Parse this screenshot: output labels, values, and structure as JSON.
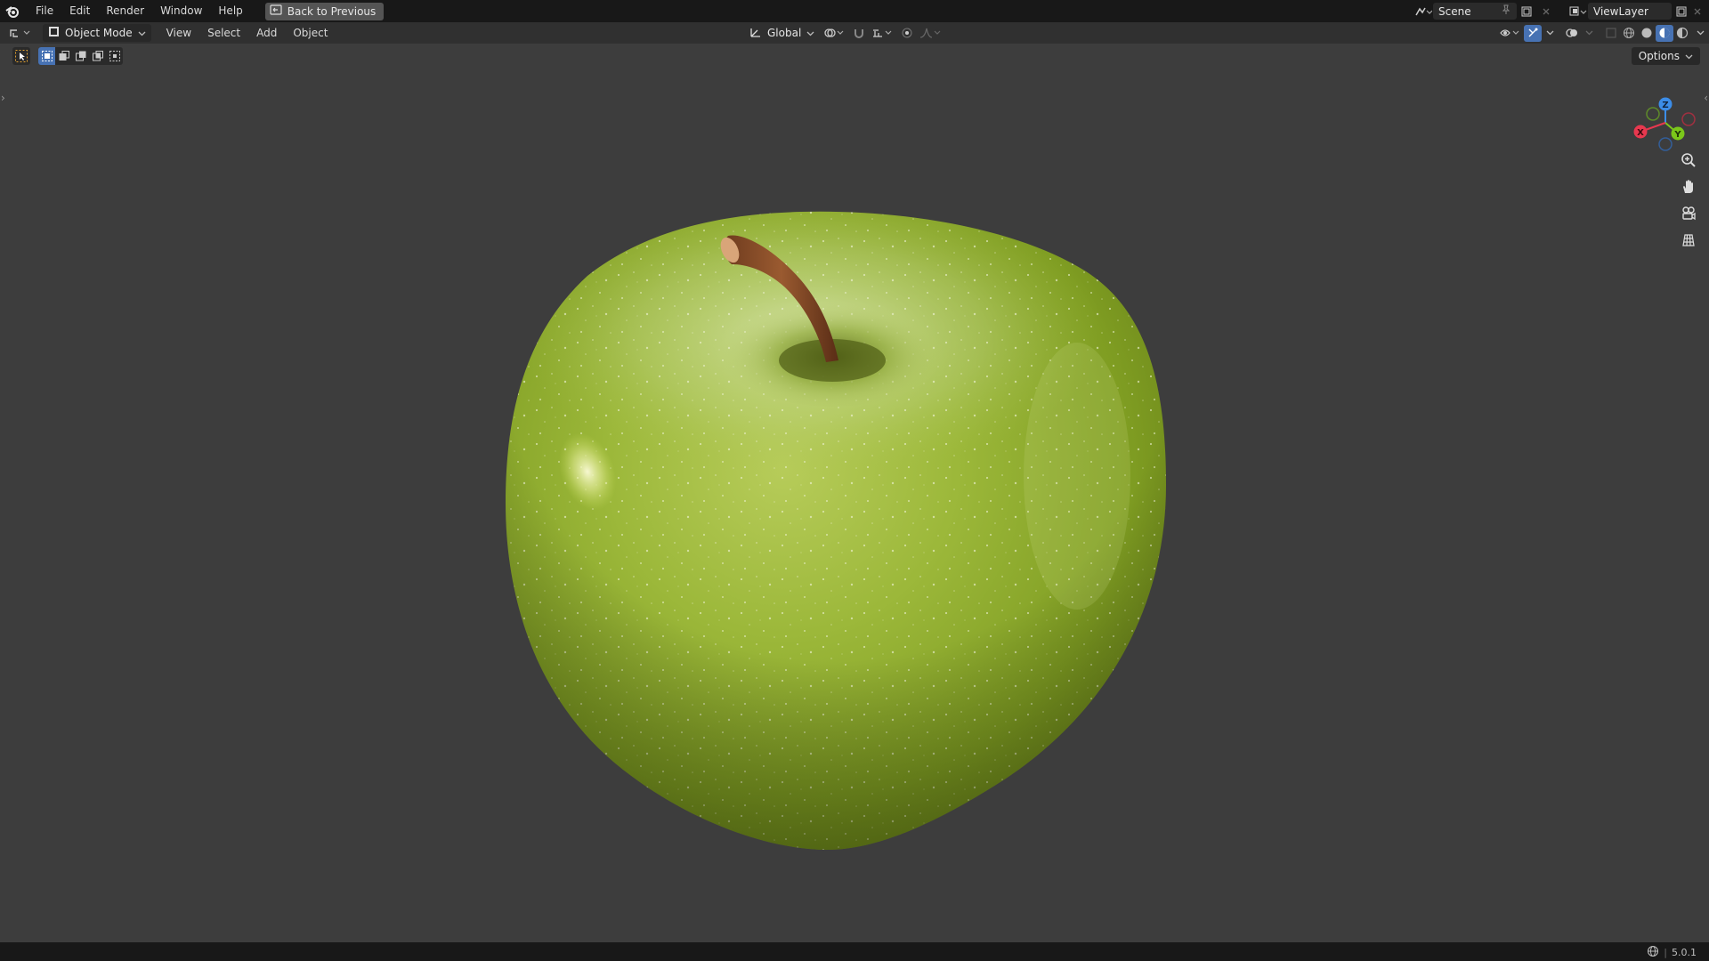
{
  "topbar": {
    "menus": [
      "File",
      "Edit",
      "Render",
      "Window",
      "Help"
    ],
    "back_label": "Back to Previous",
    "scene_label": "Scene",
    "view_layer_label": "ViewLayer"
  },
  "header": {
    "mode_label": "Object Mode",
    "menus": [
      "View",
      "Select",
      "Add",
      "Object"
    ],
    "orientation_label": "Global"
  },
  "toolrow": {
    "options_label": "Options"
  },
  "gizmo": {
    "x_label": "X",
    "y_label": "Y",
    "z_label": "Z",
    "x_color": "#e8384f",
    "y_color": "#7bc71a",
    "z_color": "#3c8de8"
  },
  "status": {
    "version": "5.0.1"
  },
  "colors": {
    "accent": "#4772b3",
    "viewport_bg": "#3d3d3d",
    "apple_green": "#8fb02c"
  },
  "icons": [
    "blender-logo-icon",
    "back-screen-icon",
    "editor-type-icon",
    "object-mode-icon",
    "orientation-icon",
    "pivot-icon",
    "snap-icon",
    "proportional-icon",
    "zoom-icon",
    "pan-hand-icon",
    "camera-view-icon",
    "ortho-grid-icon",
    "shading-wireframe-icon",
    "shading-solid-icon",
    "shading-material-icon",
    "shading-rendered-icon",
    "network-icon"
  ]
}
